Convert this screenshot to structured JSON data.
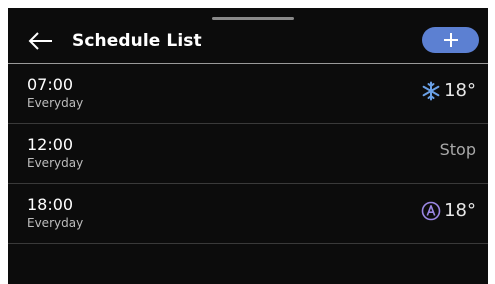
{
  "header": {
    "title": "Schedule List",
    "back_icon": "arrow-left-icon",
    "add_icon": "plus-icon",
    "accent_color": "#5c80d2"
  },
  "schedules": [
    {
      "time": "07:00",
      "repeat": "Everyday",
      "mode_icon": "cool-snowflake-icon",
      "mode_color": "#6aa0e6",
      "status": "18°"
    },
    {
      "time": "12:00",
      "repeat": "Everyday",
      "mode_icon": "",
      "mode_color": "",
      "status": "Stop"
    },
    {
      "time": "18:00",
      "repeat": "Everyday",
      "mode_icon": "auto-mode-icon",
      "mode_color": "#9a86e2",
      "status": "18°"
    }
  ]
}
